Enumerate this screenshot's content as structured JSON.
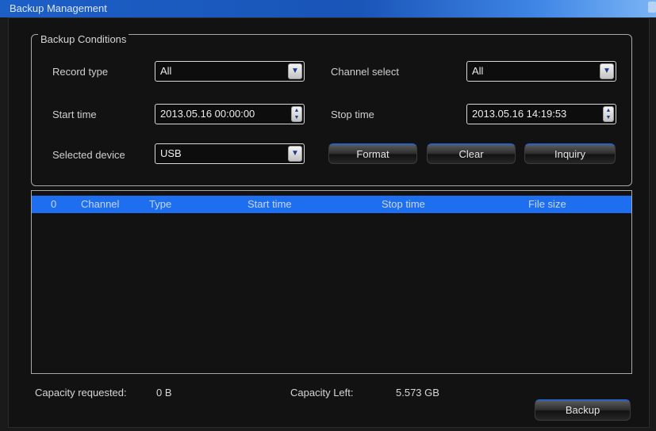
{
  "window": {
    "title": "Backup Management"
  },
  "conditions": {
    "legend": "Backup Conditions",
    "record_type": {
      "label": "Record type",
      "value": "All"
    },
    "channel_select": {
      "label": "Channel select",
      "value": "All"
    },
    "start_time": {
      "label": "Start time",
      "value": "2013.05.16 00:00:00"
    },
    "stop_time": {
      "label": "Stop time",
      "value": "2013.05.16 14:19:53"
    },
    "selected_device": {
      "label": "Selected device",
      "value": "USB"
    },
    "buttons": {
      "format": "Format",
      "clear": "Clear",
      "inquiry": "Inquiry"
    }
  },
  "table": {
    "columns": [
      "0",
      "Channel",
      "Type",
      "Start time",
      "Stop time",
      "File size"
    ],
    "rows": []
  },
  "status": {
    "capacity_requested_label": "Capacity requested:",
    "capacity_requested_value": "0 B",
    "capacity_left_label": "Capacity Left:",
    "capacity_left_value": "5.573 GB"
  },
  "actions": {
    "backup": "Backup"
  },
  "colors": {
    "accent": "#1e6ff0",
    "title_bar": "#1a55b8",
    "background": "#121212"
  },
  "icons": {
    "dropdown": "chevron-down-icon",
    "spinner": "spin-arrows-icon"
  }
}
